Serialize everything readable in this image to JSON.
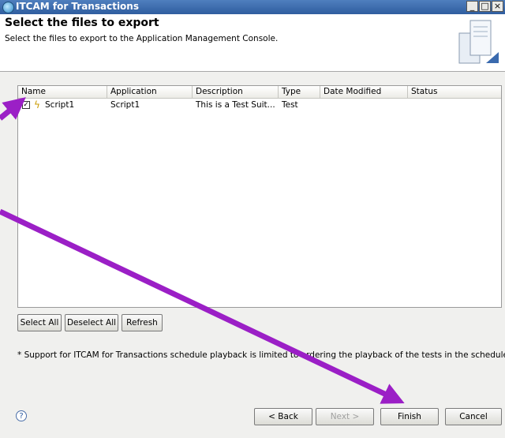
{
  "window": {
    "title": "ITCAM for Transactions",
    "minimize": "_",
    "maximize": "□",
    "close": "×"
  },
  "header": {
    "title": "Select the files to export",
    "description": "Select the files to export to the Application Management Console."
  },
  "table": {
    "columns": [
      "Name",
      "Application",
      "Description",
      "Type",
      "Date Modified",
      "Status"
    ],
    "rows": [
      {
        "checked": true,
        "check_glyph": "✓",
        "name": "Script1",
        "application": "Script1",
        "description": "This is a Test Suit...",
        "type": "Test",
        "date_modified": "",
        "status": ""
      }
    ]
  },
  "selection_buttons": {
    "select_all": "Select All",
    "deselect_all": "Deselect All",
    "refresh": "Refresh"
  },
  "note": "* Support for ITCAM for Transactions schedule playback is limited to ordering the playback of the tests in the schedule.",
  "footer": {
    "help": "?",
    "back": "< Back",
    "next": "Next >",
    "finish": "Finish",
    "cancel": "Cancel"
  },
  "icons": {
    "app": "itcam-globe-icon",
    "wizard": "server-document-icon",
    "script": "script-icon",
    "help": "help-icon"
  },
  "colors": {
    "annotation_arrow": "#9b1fc6",
    "titlebar": "#3a6aae"
  }
}
